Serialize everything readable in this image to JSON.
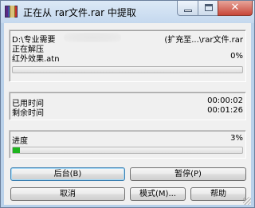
{
  "window": {
    "title": "正在从 rar文件.rar 中提取",
    "controls": {
      "minimize": "minimize",
      "maximize": "maximize",
      "close": "✕"
    }
  },
  "extract": {
    "path_prefix": "D:\\专业需要",
    "path_suffix": "(扩充至...\\rar文件.rar",
    "status_label": "正在解压",
    "current_file": "红外效果.atn",
    "file_percent": "0%",
    "file_progress": 0
  },
  "time": {
    "elapsed_label": "已用时间",
    "elapsed_value": "00:00:02",
    "remaining_label": "剩余时间",
    "remaining_value": "00:01:26"
  },
  "overall": {
    "label": "进度",
    "percent": "3%",
    "progress": 0.03
  },
  "buttons": {
    "background": "后台(B)",
    "pause": "暂停(P)",
    "cancel": "取消",
    "mode": "模式(M)...",
    "help": "帮助"
  },
  "colors": {
    "progress_fill": "#1fb51f",
    "title_bar": "#c4d8ee",
    "close_button": "#c8473a"
  }
}
